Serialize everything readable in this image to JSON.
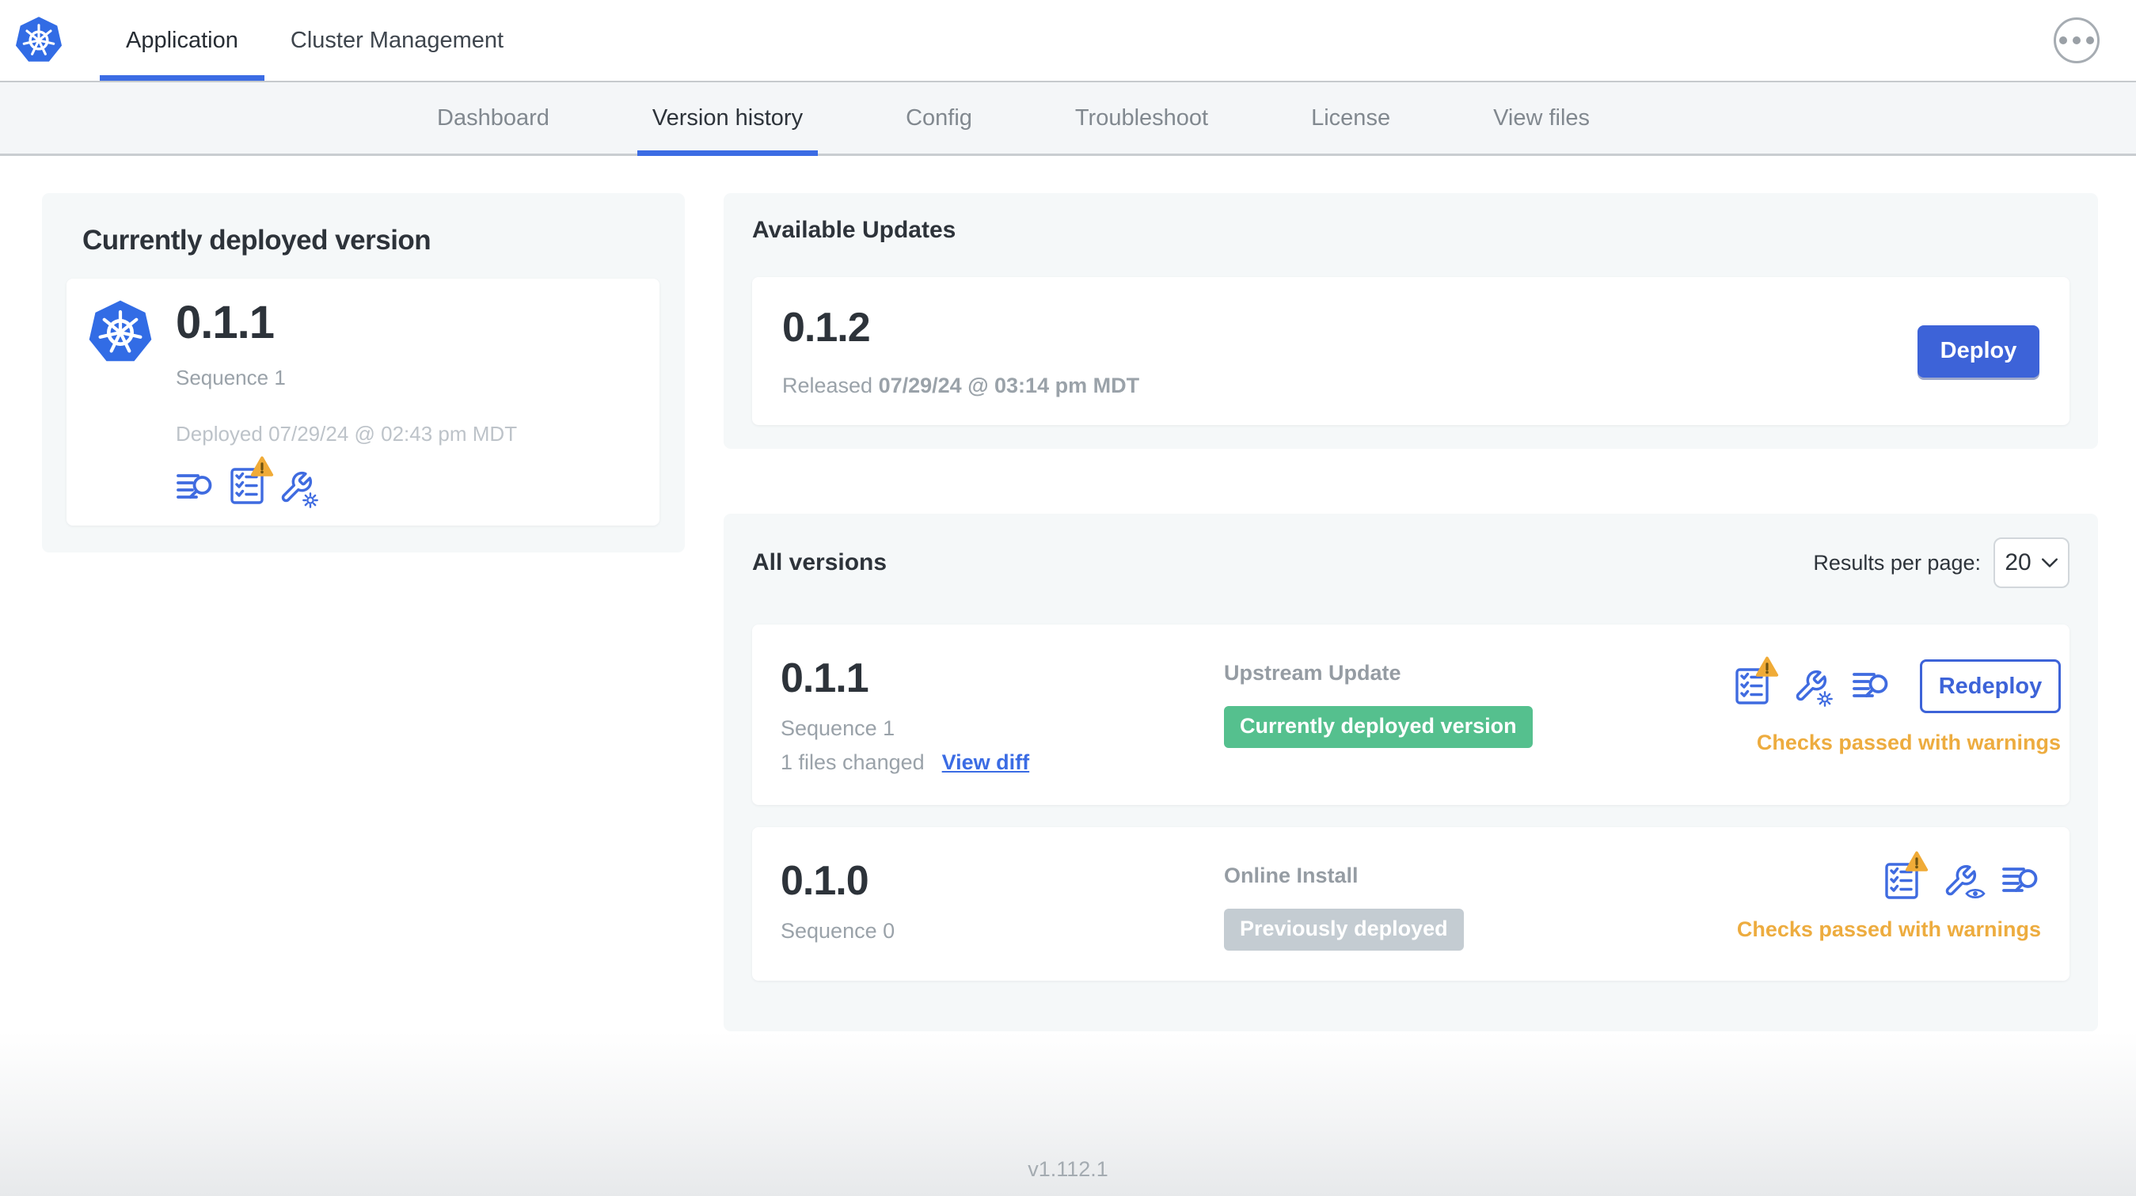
{
  "header": {
    "tabs": [
      {
        "label": "Application"
      },
      {
        "label": "Cluster Management"
      }
    ]
  },
  "subnav": {
    "items": [
      {
        "label": "Dashboard"
      },
      {
        "label": "Version history"
      },
      {
        "label": "Config"
      },
      {
        "label": "Troubleshoot"
      },
      {
        "label": "License"
      },
      {
        "label": "View files"
      }
    ]
  },
  "currently_deployed": {
    "title": "Currently deployed version",
    "version": "0.1.1",
    "sequence": "Sequence 1",
    "deployed": "Deployed 07/29/24 @ 02:43 pm MDT",
    "icons": [
      "diff-icon",
      "preflight-checks-warning-icon",
      "edit-config-icon"
    ]
  },
  "available_updates": {
    "title": "Available Updates",
    "update": {
      "version": "0.1.2",
      "released_label": "Released",
      "released_date": "07/29/24 @ 03:14 pm MDT",
      "deploy_label": "Deploy"
    }
  },
  "all_versions": {
    "title": "All versions",
    "results_per_page_label": "Results per page:",
    "results_per_page_value": "20",
    "rows": [
      {
        "version": "0.1.1",
        "sequence": "Sequence 1",
        "files_changed": "1 files changed",
        "view_diff": "View diff",
        "source": "Upstream Update",
        "badge": "Currently deployed version",
        "badge_type": "green",
        "icons": [
          "preflight-checks-warning-icon",
          "edit-config-icon",
          "diff-icon"
        ],
        "checks": "Checks passed with warnings",
        "action": "Redeploy"
      },
      {
        "version": "0.1.0",
        "sequence": "Sequence 0",
        "source": "Online Install",
        "badge": "Previously deployed",
        "badge_type": "gray",
        "icons": [
          "preflight-checks-warning-icon",
          "view-config-icon",
          "diff-icon"
        ],
        "checks": "Checks passed with warnings"
      }
    ]
  },
  "footer": {
    "app_version": "v1.112.1"
  },
  "colors": {
    "accent_blue": "#3b6ce4",
    "icon_blue": "#3f6be0",
    "deploy_button_blue": "#3d63d8",
    "kubernetes_blue": "#326ce5",
    "badge_green": "#55c08e",
    "badge_gray": "#c4ccd2",
    "warning_orange": "#edac3f",
    "card_background": "#f5f8f9"
  }
}
